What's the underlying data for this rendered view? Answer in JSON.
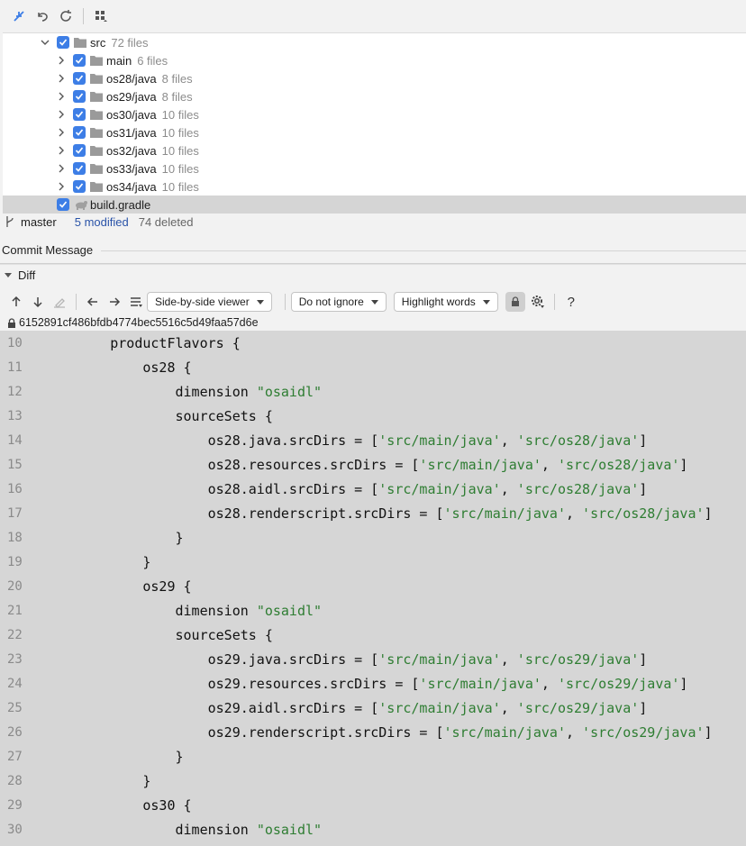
{
  "tree": {
    "items": [
      {
        "name": "src",
        "count": "72 files",
        "indent": 1,
        "expanded": true,
        "type": "folder",
        "selected": false
      },
      {
        "name": "main",
        "count": "6 files",
        "indent": 2,
        "expanded": false,
        "type": "folder",
        "selected": false
      },
      {
        "name": "os28/java",
        "count": "8 files",
        "indent": 2,
        "expanded": false,
        "type": "folder",
        "selected": false
      },
      {
        "name": "os29/java",
        "count": "8 files",
        "indent": 2,
        "expanded": false,
        "type": "folder",
        "selected": false
      },
      {
        "name": "os30/java",
        "count": "10 files",
        "indent": 2,
        "expanded": false,
        "type": "folder",
        "selected": false
      },
      {
        "name": "os31/java",
        "count": "10 files",
        "indent": 2,
        "expanded": false,
        "type": "folder",
        "selected": false
      },
      {
        "name": "os32/java",
        "count": "10 files",
        "indent": 2,
        "expanded": false,
        "type": "folder",
        "selected": false
      },
      {
        "name": "os33/java",
        "count": "10 files",
        "indent": 2,
        "expanded": false,
        "type": "folder",
        "selected": false
      },
      {
        "name": "os34/java",
        "count": "10 files",
        "indent": 2,
        "expanded": false,
        "type": "folder",
        "selected": false
      },
      {
        "name": "build.gradle",
        "count": "",
        "indent": 1,
        "expanded": null,
        "type": "gradle",
        "selected": true
      }
    ]
  },
  "status": {
    "branch": "master",
    "modified": "5 modified",
    "deleted": "74 deleted"
  },
  "commit": {
    "label": "Commit Message"
  },
  "diff": {
    "title": "Diff",
    "viewer": "Side-by-side viewer",
    "ignore": "Do not ignore",
    "highlight": "Highlight words",
    "help": "?",
    "hash": "6152891cf486bfdb4774bec5516c5d49faa57d6e"
  },
  "code": {
    "lines": [
      {
        "n": "10",
        "parts": [
          {
            "t": "        productFlavors {",
            "s": false
          }
        ]
      },
      {
        "n": "11",
        "parts": [
          {
            "t": "            os28 {",
            "s": false
          }
        ]
      },
      {
        "n": "12",
        "parts": [
          {
            "t": "                dimension ",
            "s": false
          },
          {
            "t": "\"osaidl\"",
            "s": true
          }
        ]
      },
      {
        "n": "13",
        "parts": [
          {
            "t": "                sourceSets {",
            "s": false
          }
        ]
      },
      {
        "n": "14",
        "parts": [
          {
            "t": "                    os28.java.srcDirs = [",
            "s": false
          },
          {
            "t": "'src/main/java'",
            "s": true
          },
          {
            "t": ", ",
            "s": false
          },
          {
            "t": "'src/os28/java'",
            "s": true
          },
          {
            "t": "]",
            "s": false
          }
        ]
      },
      {
        "n": "15",
        "parts": [
          {
            "t": "                    os28.resources.srcDirs = [",
            "s": false
          },
          {
            "t": "'src/main/java'",
            "s": true
          },
          {
            "t": ", ",
            "s": false
          },
          {
            "t": "'src/os28/java'",
            "s": true
          },
          {
            "t": "]",
            "s": false
          }
        ]
      },
      {
        "n": "16",
        "parts": [
          {
            "t": "                    os28.aidl.srcDirs = [",
            "s": false
          },
          {
            "t": "'src/main/java'",
            "s": true
          },
          {
            "t": ", ",
            "s": false
          },
          {
            "t": "'src/os28/java'",
            "s": true
          },
          {
            "t": "]",
            "s": false
          }
        ]
      },
      {
        "n": "17",
        "parts": [
          {
            "t": "                    os28.renderscript.srcDirs = [",
            "s": false
          },
          {
            "t": "'src/main/java'",
            "s": true
          },
          {
            "t": ", ",
            "s": false
          },
          {
            "t": "'src/os28/java'",
            "s": true
          },
          {
            "t": "]",
            "s": false
          }
        ]
      },
      {
        "n": "18",
        "parts": [
          {
            "t": "                }",
            "s": false
          }
        ]
      },
      {
        "n": "19",
        "parts": [
          {
            "t": "            }",
            "s": false
          }
        ]
      },
      {
        "n": "20",
        "parts": [
          {
            "t": "            os29 {",
            "s": false
          }
        ]
      },
      {
        "n": "21",
        "parts": [
          {
            "t": "                dimension ",
            "s": false
          },
          {
            "t": "\"osaidl\"",
            "s": true
          }
        ]
      },
      {
        "n": "22",
        "parts": [
          {
            "t": "                sourceSets {",
            "s": false
          }
        ]
      },
      {
        "n": "23",
        "parts": [
          {
            "t": "                    os29.java.srcDirs = [",
            "s": false
          },
          {
            "t": "'src/main/java'",
            "s": true
          },
          {
            "t": ", ",
            "s": false
          },
          {
            "t": "'src/os29/java'",
            "s": true
          },
          {
            "t": "]",
            "s": false
          }
        ]
      },
      {
        "n": "24",
        "parts": [
          {
            "t": "                    os29.resources.srcDirs = [",
            "s": false
          },
          {
            "t": "'src/main/java'",
            "s": true
          },
          {
            "t": ", ",
            "s": false
          },
          {
            "t": "'src/os29/java'",
            "s": true
          },
          {
            "t": "]",
            "s": false
          }
        ]
      },
      {
        "n": "25",
        "parts": [
          {
            "t": "                    os29.aidl.srcDirs = [",
            "s": false
          },
          {
            "t": "'src/main/java'",
            "s": true
          },
          {
            "t": ", ",
            "s": false
          },
          {
            "t": "'src/os29/java'",
            "s": true
          },
          {
            "t": "]",
            "s": false
          }
        ]
      },
      {
        "n": "26",
        "parts": [
          {
            "t": "                    os29.renderscript.srcDirs = [",
            "s": false
          },
          {
            "t": "'src/main/java'",
            "s": true
          },
          {
            "t": ", ",
            "s": false
          },
          {
            "t": "'src/os29/java'",
            "s": true
          },
          {
            "t": "]",
            "s": false
          }
        ]
      },
      {
        "n": "27",
        "parts": [
          {
            "t": "                }",
            "s": false
          }
        ]
      },
      {
        "n": "28",
        "parts": [
          {
            "t": "            }",
            "s": false
          }
        ]
      },
      {
        "n": "29",
        "parts": [
          {
            "t": "            os30 {",
            "s": false
          }
        ]
      },
      {
        "n": "30",
        "parts": [
          {
            "t": "                dimension ",
            "s": false
          },
          {
            "t": "\"osaidl\"",
            "s": true
          }
        ]
      }
    ]
  }
}
